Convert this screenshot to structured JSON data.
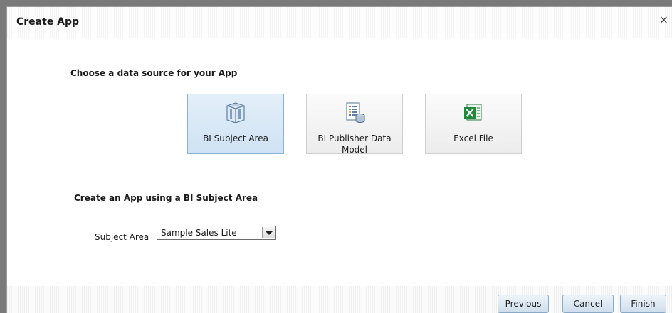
{
  "dialog": {
    "title": "Create App",
    "close_glyph": "×"
  },
  "source": {
    "heading": "Choose a data source for your App",
    "tiles": [
      {
        "label": "BI Subject Area",
        "icon": "subject-area-icon",
        "selected": true
      },
      {
        "label": "BI Publisher Data Model",
        "icon": "data-model-icon",
        "selected": false
      },
      {
        "label": "Excel File",
        "icon": "excel-icon",
        "selected": false
      }
    ]
  },
  "subject": {
    "heading": "Create an App using a BI Subject Area",
    "field_label": "Subject Area",
    "value": "Sample Sales Lite"
  },
  "buttons": {
    "previous": "Previous",
    "cancel": "Cancel",
    "finish": "Finish"
  },
  "colors": {
    "selected_tile": "#cfe2f3",
    "button": "#cfdeec",
    "excel_green": "#1f8a3a"
  }
}
